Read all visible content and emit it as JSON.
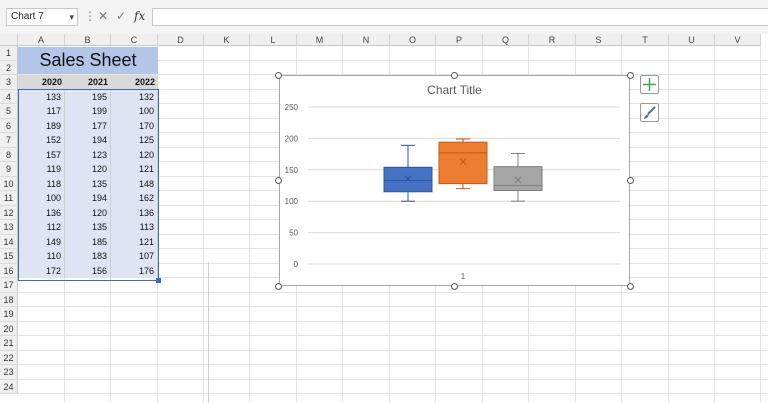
{
  "formula_bar": {
    "name_box": "Chart 7",
    "fx": "fx",
    "formula": ""
  },
  "columns": [
    "A",
    "B",
    "C",
    "D",
    "K",
    "L",
    "M",
    "N",
    "O",
    "P",
    "Q",
    "R",
    "S",
    "T",
    "U",
    "V"
  ],
  "rows": [
    "1",
    "2",
    "3",
    "4",
    "5",
    "6",
    "7",
    "8",
    "9",
    "10",
    "11",
    "12",
    "13",
    "14",
    "15",
    "16",
    "17",
    "18",
    "19",
    "20",
    "21",
    "22",
    "23",
    "24"
  ],
  "sheet": {
    "title": "Sales Sheet",
    "headers": [
      "2020",
      "2021",
      "2022"
    ],
    "data": [
      [
        133,
        195,
        132
      ],
      [
        117,
        199,
        100
      ],
      [
        189,
        177,
        170
      ],
      [
        152,
        194,
        125
      ],
      [
        157,
        123,
        120
      ],
      [
        119,
        120,
        121
      ],
      [
        118,
        135,
        148
      ],
      [
        100,
        194,
        162
      ],
      [
        136,
        120,
        136
      ],
      [
        112,
        135,
        113
      ],
      [
        149,
        185,
        121
      ],
      [
        110,
        183,
        107
      ],
      [
        172,
        156,
        176
      ]
    ]
  },
  "chart_data": {
    "type": "box",
    "title": "Chart Title",
    "categories": [
      "1"
    ],
    "ylim": [
      0,
      250
    ],
    "yticks": [
      0,
      50,
      100,
      150,
      200,
      250
    ],
    "grid": true,
    "series": [
      {
        "color": "#4472c4",
        "min": 100,
        "q1": 115,
        "median": 133,
        "q3": 154,
        "max": 189,
        "mean": 136
      },
      {
        "color": "#ed7d31",
        "min": 120,
        "q1": 128,
        "median": 177,
        "q3": 194,
        "max": 199,
        "mean": 163
      },
      {
        "color": "#a5a5a5",
        "min": 100,
        "q1": 117,
        "median": 125,
        "q3": 155,
        "max": 176,
        "mean": 134
      }
    ]
  },
  "chart_buttons": {
    "add_elements": "chart-elements-icon",
    "styles": "chart-styles-icon"
  }
}
